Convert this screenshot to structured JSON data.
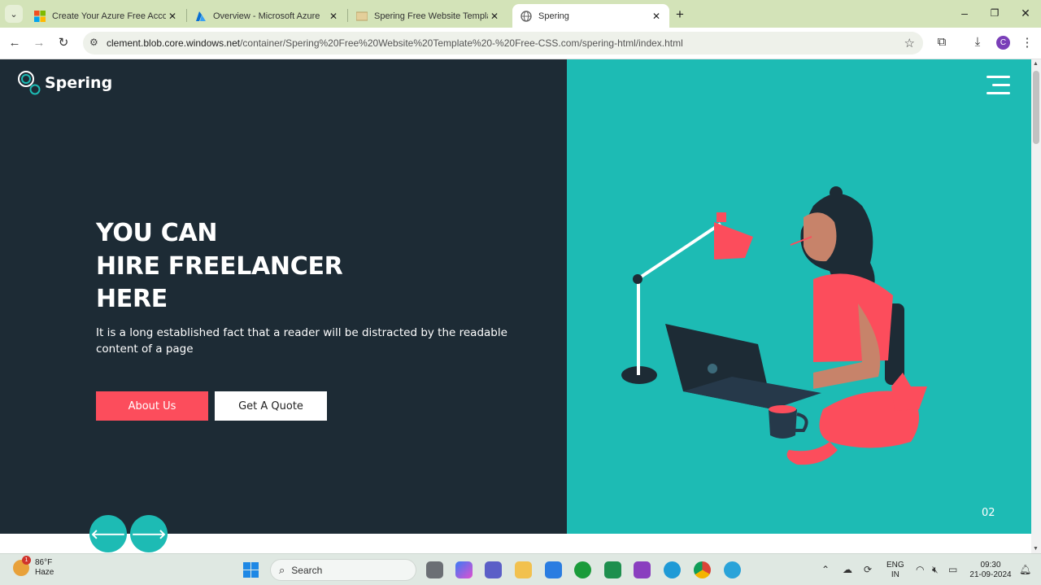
{
  "browser": {
    "tabs": [
      {
        "title": "Create Your Azure Free Account",
        "active": false
      },
      {
        "title": "Overview - Microsoft Azure",
        "active": false
      },
      {
        "title": "Spering Free Website Template",
        "active": false
      },
      {
        "title": "Spering",
        "active": true
      }
    ],
    "url_host": "clement.blob.core.windows.net",
    "url_path": "/container/Spering%20Free%20Website%20Template%20-%20Free-CSS.com/spering-html/index.html",
    "profile_initial": "C"
  },
  "site": {
    "logo_text": "Spering",
    "hero_title_lines": [
      "YOU CAN",
      "HIRE FREELANCER",
      "HERE"
    ],
    "hero_subtitle": "It is a long established fact that a reader will be distracted by the readable content of a page",
    "about_button": "About Us",
    "quote_button": "Get A Quote",
    "slide_number": "02",
    "colors": {
      "dark": "#1d2b35",
      "teal": "#1dbbb4",
      "coral": "#fc4d5c"
    }
  },
  "taskbar": {
    "weather_temp": "86°F",
    "weather_desc": "Haze",
    "weather_badge": "1",
    "search_label": "Search",
    "lang_line1": "ENG",
    "lang_line2": "IN",
    "time": "09:30",
    "date": "21-09-2024"
  }
}
